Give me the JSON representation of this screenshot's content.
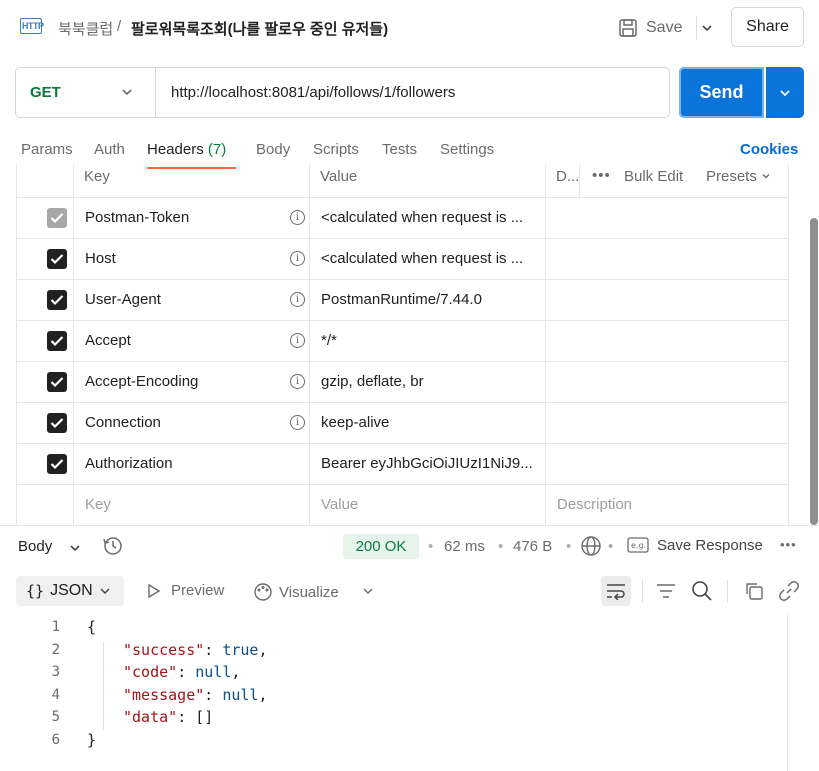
{
  "header": {
    "app_icon_label": "HTTP",
    "breadcrumb_parent": "북북클럽",
    "breadcrumb_sep": "/",
    "title": "팔로워목록조회(나를 팔로우 중인 유저들)",
    "save_label": "Save",
    "share_label": "Share"
  },
  "request": {
    "method": "GET",
    "url": "http://localhost:8081/api/follows/1/followers",
    "send_label": "Send"
  },
  "tabs": {
    "params": "Params",
    "auth": "Auth",
    "headers": "Headers",
    "headers_count": "(7)",
    "body": "Body",
    "scripts": "Scripts",
    "tests": "Tests",
    "settings": "Settings",
    "cookies": "Cookies"
  },
  "headers_table": {
    "col_key": "Key",
    "col_value": "Value",
    "col_description": "D...",
    "bulk_edit": "Bulk Edit",
    "presets": "Presets",
    "rows": [
      {
        "key": "Postman-Token",
        "value": "<calculated when request is ...",
        "checked": true,
        "disabled": true,
        "info": true
      },
      {
        "key": "Host",
        "value": "<calculated when request is ...",
        "checked": true,
        "disabled": false,
        "info": true
      },
      {
        "key": "User-Agent",
        "value": "PostmanRuntime/7.44.0",
        "checked": true,
        "disabled": false,
        "info": true
      },
      {
        "key": "Accept",
        "value": "*/*",
        "checked": true,
        "disabled": false,
        "info": true
      },
      {
        "key": "Accept-Encoding",
        "value": "gzip, deflate, br",
        "checked": true,
        "disabled": false,
        "info": true
      },
      {
        "key": "Connection",
        "value": "keep-alive",
        "checked": true,
        "disabled": false,
        "info": true
      },
      {
        "key": "Authorization",
        "value": "Bearer eyJhbGciOiJIUzI1NiJ9...",
        "checked": true,
        "disabled": false,
        "info": false
      }
    ],
    "empty_key_placeholder": "Key",
    "empty_value_placeholder": "Value",
    "empty_description_placeholder": "Description"
  },
  "response": {
    "section_label": "Body",
    "status": "200 OK",
    "time": "62 ms",
    "size": "476 B",
    "save_response": "Save Response",
    "format": "JSON",
    "preview": "Preview",
    "visualize": "Visualize",
    "status_color": "#0b7a3e"
  },
  "code": {
    "line_numbers": [
      "1",
      "2",
      "3",
      "4",
      "5",
      "6"
    ],
    "open_brace": "{",
    "close_brace": "}",
    "key_success": "\"success\"",
    "val_success": "true",
    "key_code": "\"code\"",
    "val_code": "null",
    "key_message": "\"message\"",
    "val_message": "null",
    "key_data": "\"data\"",
    "val_data": "[]"
  },
  "colors": {
    "accent": "#0a74da",
    "tab_underline": "#f26b3a",
    "method_get": "#0b7a3e"
  }
}
